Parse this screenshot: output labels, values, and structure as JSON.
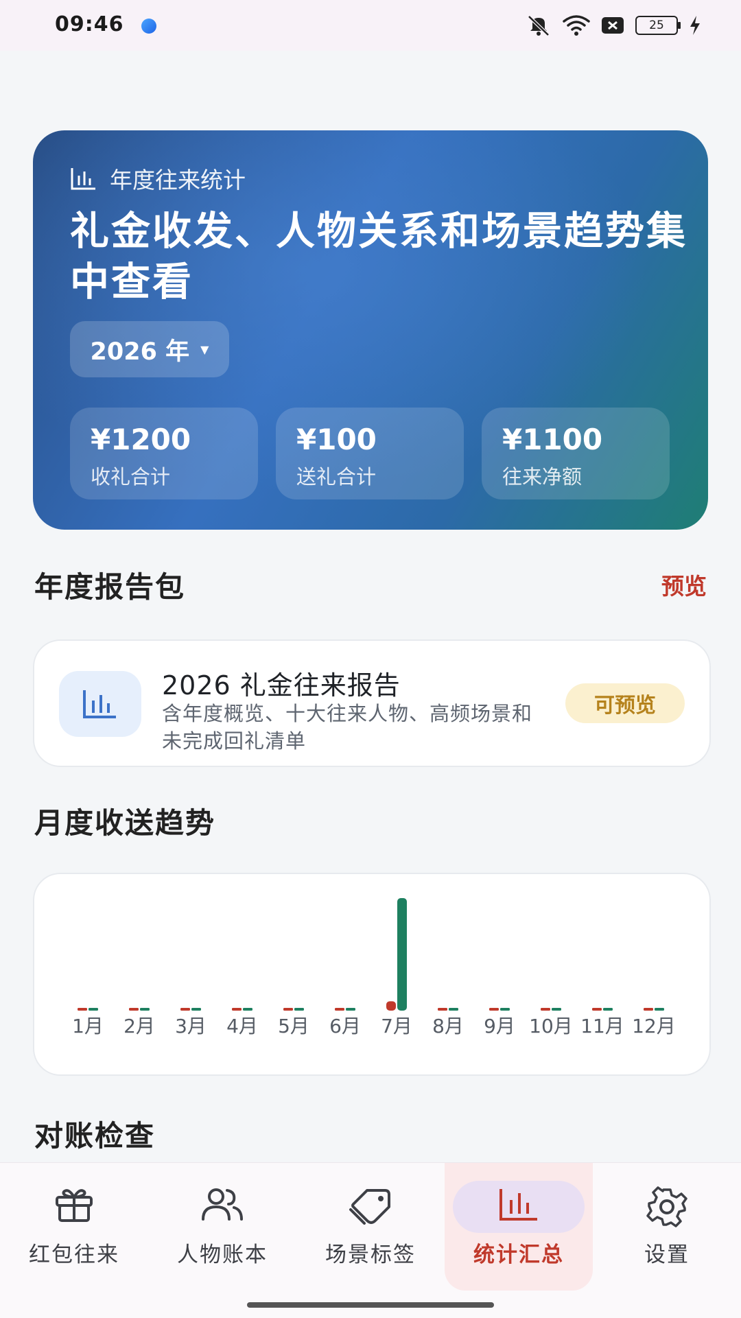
{
  "status_bar": {
    "time": "09:46",
    "battery": "25"
  },
  "hero": {
    "eyebrow": "年度往来统计",
    "title": "礼金收发、人物关系和场景趋势集中查看",
    "year_select": "2026 年",
    "stats": [
      {
        "value": "¥1200",
        "label": "收礼合计"
      },
      {
        "value": "¥100",
        "label": "送礼合计"
      },
      {
        "value": "¥1100",
        "label": "往来净额"
      }
    ]
  },
  "report_section": {
    "title": "年度报告包",
    "link": "预览",
    "card": {
      "title": "2026 礼金往来报告",
      "description": "含年度概览、十大往来人物、高频场景和未完成回礼清单",
      "badge": "可预览"
    }
  },
  "trend_section": {
    "title": "月度收送趋势"
  },
  "chart_data": {
    "type": "bar",
    "categories": [
      "1月",
      "2月",
      "3月",
      "4月",
      "5月",
      "6月",
      "7月",
      "8月",
      "9月",
      "10月",
      "11月",
      "12月"
    ],
    "series": [
      {
        "color": "#c0392b",
        "values": [
          0,
          0,
          0,
          0,
          0,
          0,
          100,
          0,
          0,
          0,
          0,
          0
        ]
      },
      {
        "color": "#1e8060",
        "values": [
          0,
          0,
          0,
          0,
          0,
          0,
          1200,
          0,
          0,
          0,
          0,
          0
        ]
      }
    ],
    "ylim": [
      0,
      1200
    ]
  },
  "reconcile_section": {
    "title": "对账检查"
  },
  "bottom_nav": {
    "items": [
      {
        "label": "红包往来",
        "icon": "gift-icon"
      },
      {
        "label": "人物账本",
        "icon": "people-icon"
      },
      {
        "label": "场景标签",
        "icon": "tag-icon"
      },
      {
        "label": "统计汇总",
        "icon": "chart-icon"
      },
      {
        "label": "设置",
        "icon": "gear-icon"
      }
    ],
    "active_index": 3,
    "active_color": "#c0392b"
  }
}
